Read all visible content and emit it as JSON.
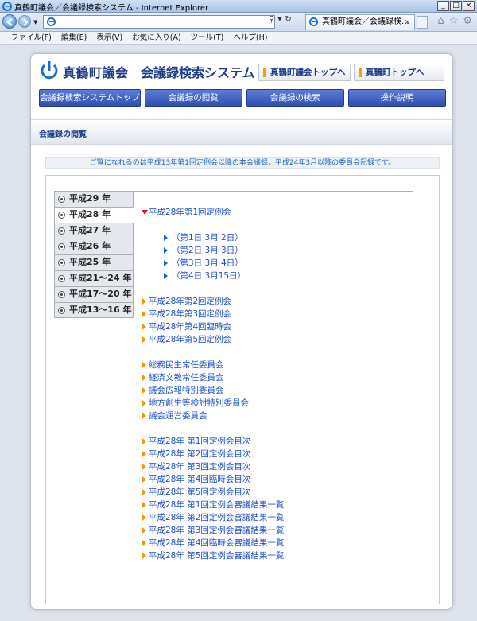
{
  "browser": {
    "window_title": "真鶴町議会／会議録検索システム - Internet Explorer",
    "tab_title": "真鶴町議会／会議録検...",
    "tab_close": "×",
    "address_value": "",
    "window_buttons": [
      "_",
      "□",
      "×"
    ],
    "menu": [
      "ファイル(F)",
      "編集(E)",
      "表示(V)",
      "お気に入り(A)",
      "ツール(T)",
      "ヘルプ(H)"
    ],
    "right_icons": [
      "home-icon",
      "star-icon",
      "gear-icon"
    ]
  },
  "header": {
    "site_name": "真鶴町議会",
    "system_name": "会議録検索システム",
    "link_council_top": "真鶴町議会トップへ",
    "link_town_top": "真鶴町トップへ"
  },
  "gnav": [
    "会議録検索システムトップ",
    "会議録の閲覧",
    "会議録の検索",
    "操作説明"
  ],
  "section_title": "会議録の閲覧",
  "notice": "ご覧になれるのは平成13年第1回定例会以降の本会議録、平成24年3月以降の委員会記録です。",
  "years": [
    {
      "label": "平成29 年",
      "active": false
    },
    {
      "label": "平成28 年",
      "active": true
    },
    {
      "label": "平成27 年",
      "active": false
    },
    {
      "label": "平成26 年",
      "active": false
    },
    {
      "label": "平成25 年",
      "active": false
    },
    {
      "label": "平成21～24 年",
      "active": false
    },
    {
      "label": "平成17～20 年",
      "active": false
    },
    {
      "label": "平成13～16 年",
      "active": false
    }
  ],
  "content": {
    "open_session": "平成28年第1回定例会",
    "days": [
      "（第1日 3月 2日）",
      "（第2日 3月 3日）",
      "（第3日 3月 4日）",
      "（第4日 3月15日）"
    ],
    "sessions": [
      "平成28年第2回定例会",
      "平成28年第3回定例会",
      "平成28年第4回臨時会",
      "平成28年第5回定例会"
    ],
    "committees": [
      "総務民生常任委員会",
      "経済文教常任委員会",
      "議会広報特別委員会",
      "地方創生等検討特別委員会",
      "議会運営委員会"
    ],
    "indexes": [
      "平成28年 第1回定例会目次",
      "平成28年 第2回定例会目次",
      "平成28年 第3回定例会目次",
      "平成28年 第4回臨時会目次",
      "平成28年 第5回定例会目次",
      "平成28年 第1回定例会審議結果一覧",
      "平成28年 第2回定例会審議結果一覧",
      "平成28年 第3回定例会審議結果一覧",
      "平成28年 第4回臨時会審議結果一覧",
      "平成28年 第5回定例会審議結果一覧"
    ]
  },
  "colors": {
    "nav_blue": "#2f4fb1",
    "link_blue": "#1b4fd0",
    "arrow_orange": "#f39800",
    "open_arrow_red": "#d61a1a"
  }
}
